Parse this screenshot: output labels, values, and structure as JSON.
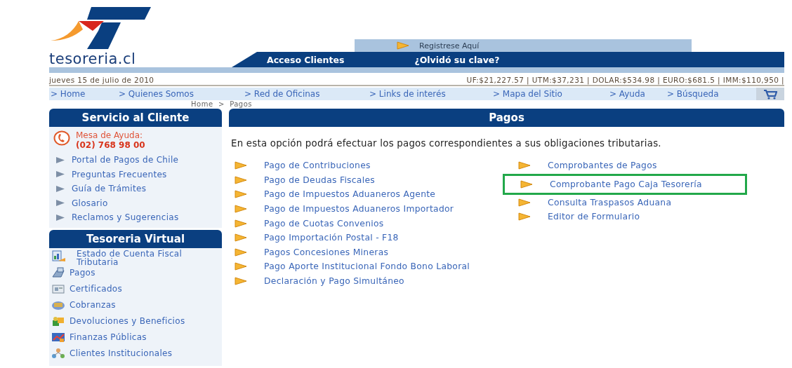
{
  "site": {
    "logo_text": "tesoreria.cl",
    "register_link": "Registrese Aquí",
    "client_access": "Acceso Clientes",
    "forgot_password": "¿Olvidó su clave?"
  },
  "info_bar": {
    "date": "jueves 15 de julio de 2010",
    "indicators": "UF:$21,227.57 | UTM:$37,231 | DOLAR:$534.98 | EURO:$681.5 | IMM:$110,950 |"
  },
  "nav": [
    "> Home",
    "> Quienes Somos",
    "> Red de Oficinas",
    "> Links de interés",
    "> Mapa del Sitio",
    "> Ayuda",
    "> Búsqueda"
  ],
  "breadcrumb": "Home  >  Pagos",
  "sidebar": {
    "customer_service": {
      "title": "Servicio al Cliente",
      "help_label": "Mesa de Ayuda:",
      "help_phone": "(02) 768 98 00",
      "links": [
        "Portal de Pagos de Chile",
        "Preguntas Frecuentes",
        "Guía de Trámites",
        "Glosario",
        "Reclamos y Sugerencias"
      ]
    },
    "virtual": {
      "title": "Tesoreria Virtual",
      "items": [
        {
          "label": "Estado de Cuenta Fiscal Tributaria",
          "kind": "account"
        },
        {
          "label": "Pagos",
          "kind": "payments"
        },
        {
          "label": "Certificados",
          "kind": "certificates"
        },
        {
          "label": "Cobranzas",
          "kind": "collections"
        },
        {
          "label": "Devoluciones y Beneficios",
          "kind": "refunds"
        },
        {
          "label": "Finanzas Públicas",
          "kind": "finance"
        },
        {
          "label": "Clientes Institucionales",
          "kind": "institutional"
        }
      ]
    }
  },
  "content": {
    "title": "Pagos",
    "intro": "En esta opción podrá efectuar los pagos correspondientes a sus obligaciones tributarias.",
    "left_links": [
      "Pago de Contribuciones",
      "Pago de Deudas Fiscales",
      "Pago de Impuestos Aduaneros Agente",
      "Pago de Impuestos Aduaneros Importador",
      "Pago de Cuotas Convenios",
      "Pago Importación Postal - F18",
      "Pagos Concesiones Mineras",
      "Pago Aporte Institucional Fondo Bono Laboral",
      "Declaración y Pago Simultáneo"
    ],
    "right_links": [
      {
        "label": "Comprobantes de Pagos",
        "highlighted": false
      },
      {
        "label": "Comprobante Pago Caja Tesorería",
        "highlighted": true
      },
      {
        "label": "Consulta Traspasos Aduana",
        "highlighted": false
      },
      {
        "label": "Editor de Formulario",
        "highlighted": false
      }
    ]
  }
}
